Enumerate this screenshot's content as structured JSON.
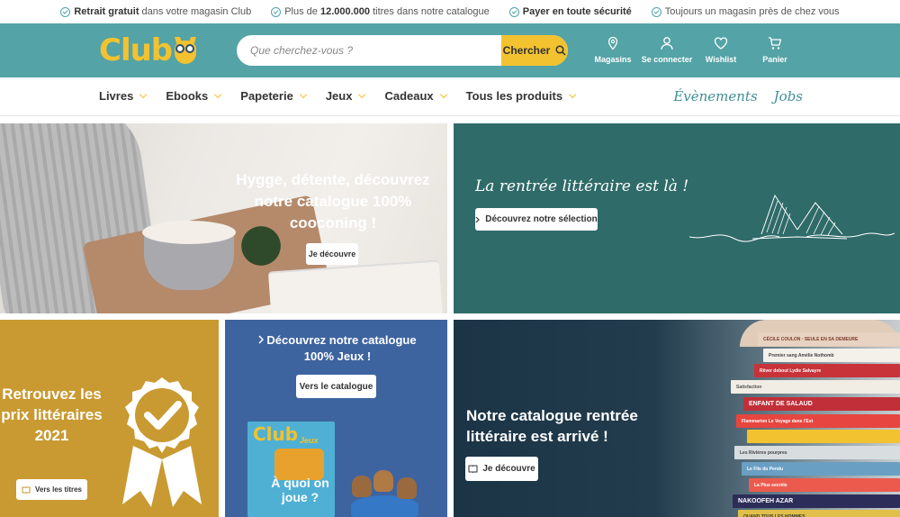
{
  "infobar": [
    {
      "bold": "Retrait gratuit",
      "text": " dans votre magasin Club"
    },
    {
      "pre": "Plus de ",
      "bold": "12.000.000",
      "text": " titres dans notre catalogue"
    },
    {
      "bold": "Payer en toute sécurité",
      "text": ""
    },
    {
      "bold": "",
      "text": "Toujours un magasin près de chez vous"
    }
  ],
  "header": {
    "logo": "Club",
    "search_placeholder": "Que cherchez-vous ?",
    "search_button": "Chercher",
    "icons": {
      "stores": "Magasins",
      "login": "Se connecter",
      "wishlist": "Wishlist",
      "cart": "Panier"
    }
  },
  "nav": {
    "items": [
      "Livres",
      "Ebooks",
      "Papeterie",
      "Jeux",
      "Cadeaux",
      "Tous les produits"
    ],
    "events": "Évènements",
    "jobs": "Jobs"
  },
  "banners": {
    "hygge": {
      "title": "Hygge, détente, découvrez notre catalogue 100% cooconing !",
      "button": "Je découvre"
    },
    "rentree": {
      "title": "La rentrée littéraire est là !",
      "button": "Découvrez notre sélection"
    },
    "prix": {
      "title": "Retrouvez les prix littéraires 2021",
      "button": "Vers les titres"
    },
    "jeux": {
      "title": "Découvrez notre catalogue 100% Jeux !",
      "button": "Vers le catalogue",
      "magazine_logo": "Club",
      "magazine_sub": "Jeux",
      "magazine_cover": "À quoi on joue ?"
    },
    "catalogue": {
      "title": "Notre catalogue rentrée littéraire est arrivé !",
      "button": "Je découvre"
    }
  },
  "book_spines": [
    "CÉCILE COULON · SEULE EN SA DEMEURE",
    "Premier sang Amélie Nothomb",
    "Rêver debout Lydie Salvayre",
    "Satisfaction",
    "ENFANT DE SALAUD",
    "Flammarion Le Voyage dans l'Est",
    "",
    "Les Rivières pourpres",
    "Le Fils du Pendu",
    "La Plus secrète",
    "NAKOOFEH AZAR",
    "QUAND TOUS LES HOMMES"
  ],
  "colors": {
    "teal": "#54a3a6",
    "yellow": "#f2c230",
    "dark_teal": "#2f6b69",
    "mustard": "#c99a32",
    "blue": "#3e64a0"
  }
}
